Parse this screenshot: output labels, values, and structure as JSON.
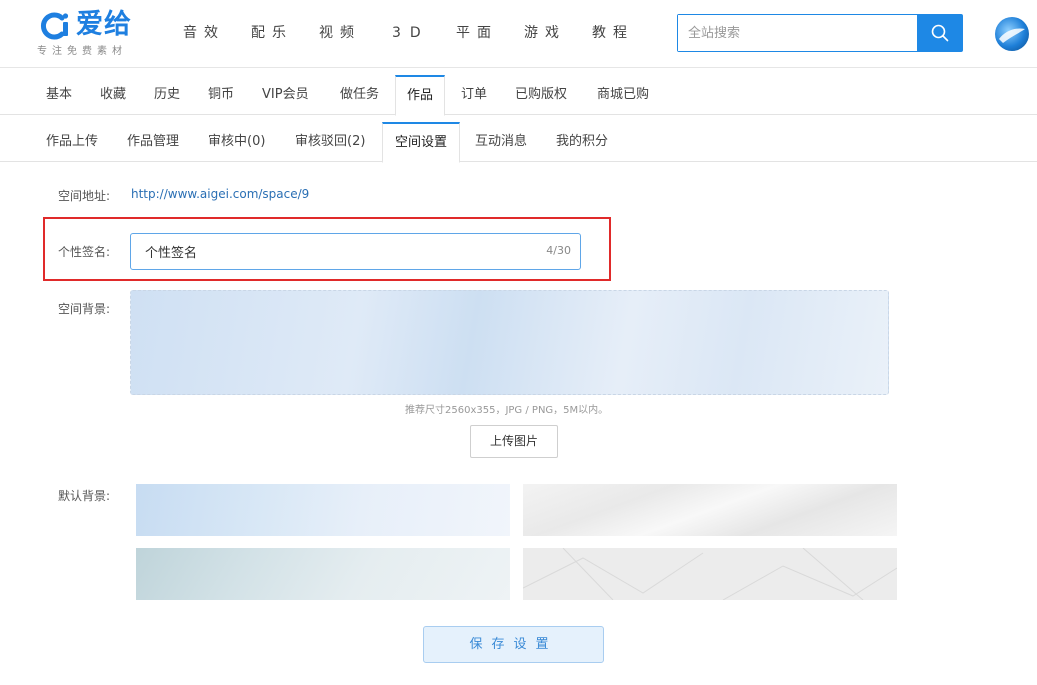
{
  "header": {
    "logo_text": "爱给",
    "slogan": "专注免费素材",
    "nav": [
      "音效",
      "配乐",
      "视频",
      "3D",
      "平面",
      "游戏",
      "教程"
    ],
    "search_placeholder": "全站搜索"
  },
  "tabs_primary": [
    "基本",
    "收藏",
    "历史",
    "铜币",
    "VIP会员",
    "做任务",
    "作品",
    "订单",
    "已购版权",
    "商城已购"
  ],
  "tabs_primary_active": "作品",
  "tabs_secondary": [
    "作品上传",
    "作品管理",
    "审核中(0)",
    "审核驳回(2)",
    "空间设置",
    "互动消息",
    "我的积分"
  ],
  "tabs_secondary_active": "空间设置",
  "form": {
    "space_url_label": "空间地址:",
    "space_url": "http://www.aigei.com/space/9",
    "signature_label": "个性签名:",
    "signature_value": "个性签名",
    "signature_count": "4/30",
    "background_label": "空间背景:",
    "background_hint": "推荐尺寸2560x355，JPG / PNG，5M以内。",
    "upload_button": "上传图片",
    "default_bg_label": "默认背景:",
    "save_button": "保存设置"
  },
  "colors": {
    "brand": "#1E88E5",
    "highlight": "#E02A2A",
    "link": "#2A6FB4"
  }
}
